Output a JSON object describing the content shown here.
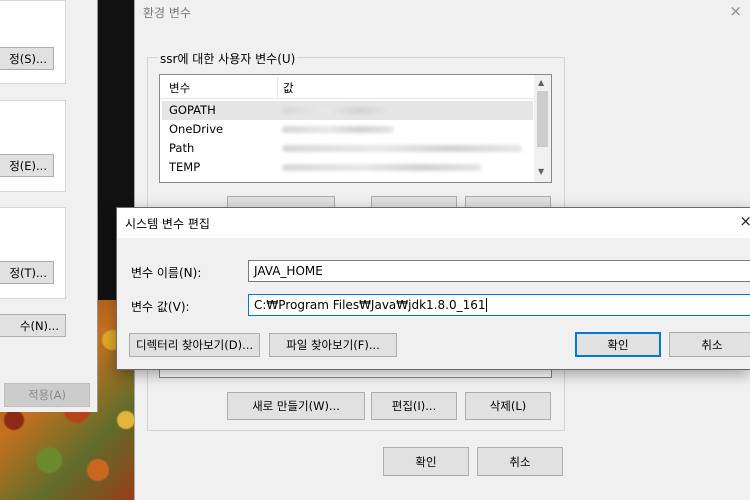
{
  "background_dialog": {
    "buttons": [
      "정(S)...",
      "정(E)...",
      "정(T)...",
      "수(N)...",
      "적용(A)"
    ]
  },
  "env_dialog": {
    "title": "환경 변수",
    "close_icon": "×",
    "user_group_label": "ssr에 대한 사용자 변수(U)",
    "columns": [
      "변수",
      "값"
    ],
    "rows": [
      {
        "name": "GOPATH"
      },
      {
        "name": "OneDrive"
      },
      {
        "name": "Path"
      },
      {
        "name": "TEMP"
      }
    ],
    "system_buttons": {
      "new": "새로 만들기(W)...",
      "edit": "편집(I)...",
      "delete": "삭제(L)"
    },
    "ok": "확인",
    "cancel": "취소"
  },
  "edit_dialog": {
    "title": "시스템 변수 편집",
    "close_icon": "×",
    "name_label": "변수 이름(N):",
    "name_value": "JAVA_HOME",
    "value_label": "변수 값(V):",
    "value_value": "C:₩Program Files₩Java₩jdk1.8.0_161",
    "browse_dir": "디렉터리 찾아보기(D)...",
    "browse_file": "파일 찾아보기(F)...",
    "ok": "확인",
    "cancel": "취소"
  }
}
